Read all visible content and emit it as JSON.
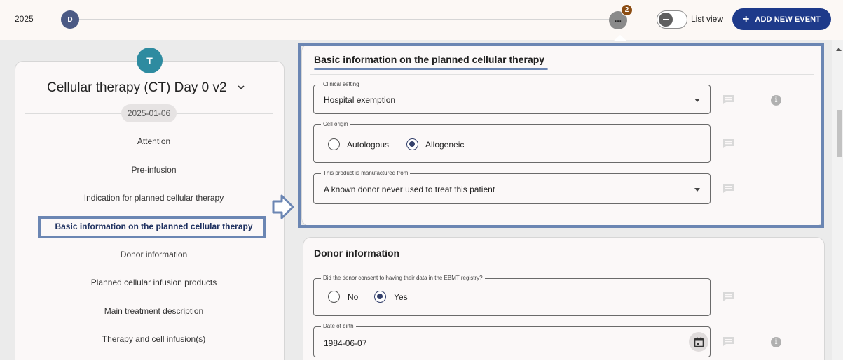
{
  "timeline": {
    "year": "2025",
    "event_d_label": "D",
    "more_label": "...",
    "more_count": "2",
    "list_view_label": "List view",
    "list_view_on": false,
    "add_event_label": "ADD NEW EVENT"
  },
  "nav": {
    "avatar_letter": "T",
    "title": "Cellular therapy (CT) Day 0 v2",
    "date": "2025-01-06",
    "active_index": 3,
    "items": [
      {
        "label": "Attention"
      },
      {
        "label": "Pre-infusion"
      },
      {
        "label": "Indication for planned cellular therapy"
      },
      {
        "label": "Basic information on the planned cellular therapy"
      },
      {
        "label": "Donor information"
      },
      {
        "label": "Planned cellular infusion products"
      },
      {
        "label": "Main treatment description"
      },
      {
        "label": "Therapy and cell infusion(s)"
      }
    ]
  },
  "basic_info": {
    "title": "Basic information on the planned cellular therapy",
    "clinical_setting": {
      "label": "Clinical setting",
      "value": "Hospital exemption"
    },
    "cell_origin": {
      "label": "Cell origin",
      "options": [
        "Autologous",
        "Allogeneic"
      ],
      "selected": "Allogeneic"
    },
    "manufactured_from": {
      "label": "This product is manufactured from",
      "value": "A known donor never used to treat this patient"
    }
  },
  "donor_info": {
    "title": "Donor information",
    "consent": {
      "label": "Did the donor consent to having their data in the EBMT registry?",
      "options": [
        "No",
        "Yes"
      ],
      "selected": "Yes"
    },
    "dob": {
      "label": "Date of birth",
      "value": "1984-06-07"
    }
  },
  "icons": {
    "comment": "comment-icon",
    "info": "info-icon",
    "calendar": "calendar-icon",
    "dropdown": "caret-down-icon",
    "chevron": "chevron-down-icon"
  },
  "colors": {
    "primary": "#1e3a8a",
    "highlight": "#6b86b3",
    "avatar": "#2e8ba0",
    "event_dot": "#4b5a84",
    "badge": "#8b4c12"
  }
}
